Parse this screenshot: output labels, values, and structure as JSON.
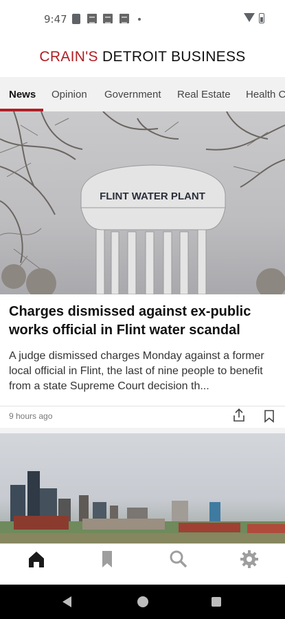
{
  "status_bar": {
    "time": "9:47"
  },
  "app": {
    "logo_part1": "CRAIN'S",
    "logo_part2": " DETROIT BUSINESS",
    "brand_color": "#b01e23"
  },
  "tabs": [
    {
      "label": "News",
      "active": true
    },
    {
      "label": "Opinion",
      "active": false
    },
    {
      "label": "Government",
      "active": false
    },
    {
      "label": "Real Estate",
      "active": false
    },
    {
      "label": "Health C",
      "active": false
    }
  ],
  "articles": [
    {
      "image_caption_text": "FLINT WATER PLANT",
      "headline": "Charges dismissed against ex-public works official in Flint water scandal",
      "summary": "A judge dismissed charges Monday against a former local official in Flint, the last of nine people to benefit from a state Supreme Court decision th...",
      "time_ago": "9 hours ago",
      "share_icon": "share-icon",
      "bookmark_icon": "bookmark-outline-icon"
    }
  ],
  "bottom_nav": [
    {
      "name": "home",
      "icon": "home-icon",
      "active": true
    },
    {
      "name": "saved",
      "icon": "bookmark-icon",
      "active": false
    },
    {
      "name": "search",
      "icon": "search-icon",
      "active": false
    },
    {
      "name": "settings",
      "icon": "gear-icon",
      "active": false
    }
  ],
  "system_nav": {
    "back": "back-triangle-icon",
    "home": "home-circle-icon",
    "recents": "recents-square-icon"
  }
}
